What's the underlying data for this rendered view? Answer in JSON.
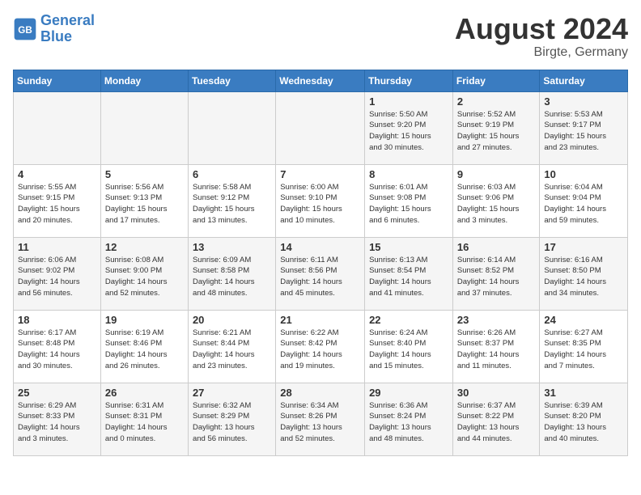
{
  "header": {
    "logo_line1": "General",
    "logo_line2": "Blue",
    "month_year": "August 2024",
    "location": "Birgte, Germany"
  },
  "days_of_week": [
    "Sunday",
    "Monday",
    "Tuesday",
    "Wednesday",
    "Thursday",
    "Friday",
    "Saturday"
  ],
  "weeks": [
    [
      {
        "day": "",
        "info": ""
      },
      {
        "day": "",
        "info": ""
      },
      {
        "day": "",
        "info": ""
      },
      {
        "day": "",
        "info": ""
      },
      {
        "day": "1",
        "info": "Sunrise: 5:50 AM\nSunset: 9:20 PM\nDaylight: 15 hours\nand 30 minutes."
      },
      {
        "day": "2",
        "info": "Sunrise: 5:52 AM\nSunset: 9:19 PM\nDaylight: 15 hours\nand 27 minutes."
      },
      {
        "day": "3",
        "info": "Sunrise: 5:53 AM\nSunset: 9:17 PM\nDaylight: 15 hours\nand 23 minutes."
      }
    ],
    [
      {
        "day": "4",
        "info": "Sunrise: 5:55 AM\nSunset: 9:15 PM\nDaylight: 15 hours\nand 20 minutes."
      },
      {
        "day": "5",
        "info": "Sunrise: 5:56 AM\nSunset: 9:13 PM\nDaylight: 15 hours\nand 17 minutes."
      },
      {
        "day": "6",
        "info": "Sunrise: 5:58 AM\nSunset: 9:12 PM\nDaylight: 15 hours\nand 13 minutes."
      },
      {
        "day": "7",
        "info": "Sunrise: 6:00 AM\nSunset: 9:10 PM\nDaylight: 15 hours\nand 10 minutes."
      },
      {
        "day": "8",
        "info": "Sunrise: 6:01 AM\nSunset: 9:08 PM\nDaylight: 15 hours\nand 6 minutes."
      },
      {
        "day": "9",
        "info": "Sunrise: 6:03 AM\nSunset: 9:06 PM\nDaylight: 15 hours\nand 3 minutes."
      },
      {
        "day": "10",
        "info": "Sunrise: 6:04 AM\nSunset: 9:04 PM\nDaylight: 14 hours\nand 59 minutes."
      }
    ],
    [
      {
        "day": "11",
        "info": "Sunrise: 6:06 AM\nSunset: 9:02 PM\nDaylight: 14 hours\nand 56 minutes."
      },
      {
        "day": "12",
        "info": "Sunrise: 6:08 AM\nSunset: 9:00 PM\nDaylight: 14 hours\nand 52 minutes."
      },
      {
        "day": "13",
        "info": "Sunrise: 6:09 AM\nSunset: 8:58 PM\nDaylight: 14 hours\nand 48 minutes."
      },
      {
        "day": "14",
        "info": "Sunrise: 6:11 AM\nSunset: 8:56 PM\nDaylight: 14 hours\nand 45 minutes."
      },
      {
        "day": "15",
        "info": "Sunrise: 6:13 AM\nSunset: 8:54 PM\nDaylight: 14 hours\nand 41 minutes."
      },
      {
        "day": "16",
        "info": "Sunrise: 6:14 AM\nSunset: 8:52 PM\nDaylight: 14 hours\nand 37 minutes."
      },
      {
        "day": "17",
        "info": "Sunrise: 6:16 AM\nSunset: 8:50 PM\nDaylight: 14 hours\nand 34 minutes."
      }
    ],
    [
      {
        "day": "18",
        "info": "Sunrise: 6:17 AM\nSunset: 8:48 PM\nDaylight: 14 hours\nand 30 minutes."
      },
      {
        "day": "19",
        "info": "Sunrise: 6:19 AM\nSunset: 8:46 PM\nDaylight: 14 hours\nand 26 minutes."
      },
      {
        "day": "20",
        "info": "Sunrise: 6:21 AM\nSunset: 8:44 PM\nDaylight: 14 hours\nand 23 minutes."
      },
      {
        "day": "21",
        "info": "Sunrise: 6:22 AM\nSunset: 8:42 PM\nDaylight: 14 hours\nand 19 minutes."
      },
      {
        "day": "22",
        "info": "Sunrise: 6:24 AM\nSunset: 8:40 PM\nDaylight: 14 hours\nand 15 minutes."
      },
      {
        "day": "23",
        "info": "Sunrise: 6:26 AM\nSunset: 8:37 PM\nDaylight: 14 hours\nand 11 minutes."
      },
      {
        "day": "24",
        "info": "Sunrise: 6:27 AM\nSunset: 8:35 PM\nDaylight: 14 hours\nand 7 minutes."
      }
    ],
    [
      {
        "day": "25",
        "info": "Sunrise: 6:29 AM\nSunset: 8:33 PM\nDaylight: 14 hours\nand 3 minutes."
      },
      {
        "day": "26",
        "info": "Sunrise: 6:31 AM\nSunset: 8:31 PM\nDaylight: 14 hours\nand 0 minutes."
      },
      {
        "day": "27",
        "info": "Sunrise: 6:32 AM\nSunset: 8:29 PM\nDaylight: 13 hours\nand 56 minutes."
      },
      {
        "day": "28",
        "info": "Sunrise: 6:34 AM\nSunset: 8:26 PM\nDaylight: 13 hours\nand 52 minutes."
      },
      {
        "day": "29",
        "info": "Sunrise: 6:36 AM\nSunset: 8:24 PM\nDaylight: 13 hours\nand 48 minutes."
      },
      {
        "day": "30",
        "info": "Sunrise: 6:37 AM\nSunset: 8:22 PM\nDaylight: 13 hours\nand 44 minutes."
      },
      {
        "day": "31",
        "info": "Sunrise: 6:39 AM\nSunset: 8:20 PM\nDaylight: 13 hours\nand 40 minutes."
      }
    ]
  ]
}
